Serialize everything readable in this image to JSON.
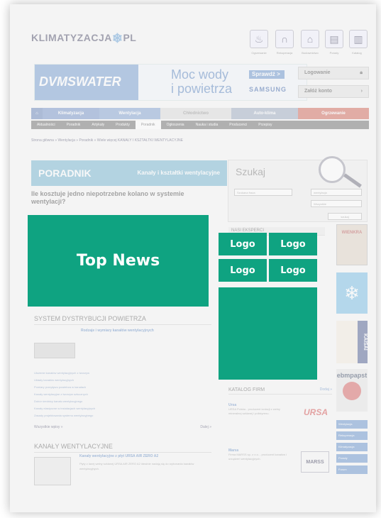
{
  "colors": {
    "overlay_green": "#0fa381",
    "nav_blue": "#4a6fae",
    "nav_red": "#c0392b"
  },
  "header": {
    "logo_text": "KLIMATYZACJA",
    "logo_suffix": "PL",
    "icons": [
      {
        "name": "fire-icon",
        "glyph": "♨",
        "label": "Ogrzewanie"
      },
      {
        "name": "arch-icon",
        "glyph": "∩",
        "label": "Rekuperacja"
      },
      {
        "name": "house-icon",
        "glyph": "⌂",
        "label": "Budownictwo"
      },
      {
        "name": "document-icon",
        "glyph": "▤",
        "label": "Porady"
      },
      {
        "name": "catalog-icon",
        "glyph": "▥",
        "label": "Katalog"
      }
    ],
    "login_label": "Logowanie",
    "register_label": "Załóż konto"
  },
  "banner": {
    "brand": "DVMSWATER",
    "headline_1": "Moc wody",
    "headline_2": "i powietrza",
    "cta": "Sprawdź >",
    "partner": "SAMSUNG"
  },
  "nav_main": [
    {
      "label": "Klimatyzacja",
      "color": "#5b7fbf"
    },
    {
      "label": "Wentylacja",
      "color": "#6a8fc8"
    },
    {
      "label": "Chłodnictwo",
      "color": "#d4d4d4"
    },
    {
      "label": "Auto-klima",
      "color": "#8a9bb5"
    },
    {
      "label": "Ogrzewanie",
      "color": "#c74a3a"
    }
  ],
  "nav_sub": [
    "Aktualności",
    "Poradnik",
    "Artykuły",
    "Produkty",
    "Poradnik",
    "Ogłoszenia",
    "Nauka i studia",
    "Producenci",
    "Przepisy"
  ],
  "breadcrumb": "Strona główna » Wentylacja » Poradnik » Wiele więcej KANAŁY I KSZTAŁTKI WENTYLACYJNE",
  "poradnik": {
    "label": "PORADNIK",
    "topic": "Kanały i kształtki wentylacyjne",
    "question": "Ile kosztuje jedno niepotrzebne kolano w systemie wentylacji?"
  },
  "search": {
    "heading": "Szukaj",
    "placeholder": "Szukana fraza",
    "category_value": "wentylacja",
    "region_value": "Wszystkie",
    "button": "szukaj"
  },
  "experts": {
    "heading": "NASI EKSPERCI"
  },
  "overlays": {
    "top_news": "Top News",
    "logos": [
      "Logo",
      "Logo",
      "Logo",
      "Logo"
    ]
  },
  "section_system": {
    "title": "SYSTEM DYSTRYBUCJI POWIETRZA",
    "lead": "Rodzaje i wymiary kanałów wentylacyjnych",
    "items": [
      "Ułożenie kanałów wentylacyjnych z tworzyw",
      "Układy kanałów wentylacyjnych",
      "Pomiary przepływu powietrza w kanałach",
      "Kanały wentylacyjne z tworzyw sztucznych",
      "Dobór średnicy kanału wentylacyjnego",
      "Kanały elastyczne w instalacjach wentylacyjnych",
      "Zasady projektowania systemu wentylacyjnego"
    ],
    "more": "Wszystkie wpisy »",
    "next": "Dalej »"
  },
  "section_channels": {
    "title": "KANAŁY WENTYLACYJNE",
    "lead": "Kanały wentylacyjne z płyt URSA AIR ZERO A2",
    "body": "Płyty z lanej wełny szklanej URSA AIR ZERO A2 idealnie nadają się do wykonania kanałów wentylacyjnych."
  },
  "katalog": {
    "heading": "KATALOG FIRM",
    "link": "Dodaj »",
    "entries": [
      {
        "name": "Ursa",
        "desc": "URSA Polska - producent izolacji z wełny mineralnej szklanej i polistyrenu.",
        "brand": "URSA"
      },
      {
        "name": "Marss",
        "desc": "Firma MARSS sp. z o.o. - producent kanałów i urządzeń wentylacyjnych.",
        "brand": "MARSS"
      }
    ]
  },
  "right_banners": [
    "WIENKRA",
    "snowflake",
    "KAISAI",
    "ebmpapst"
  ],
  "right_links": [
    "Wentylacja",
    "Rekuperacja",
    "Klimatyzacja",
    "Porady",
    "Forum"
  ]
}
